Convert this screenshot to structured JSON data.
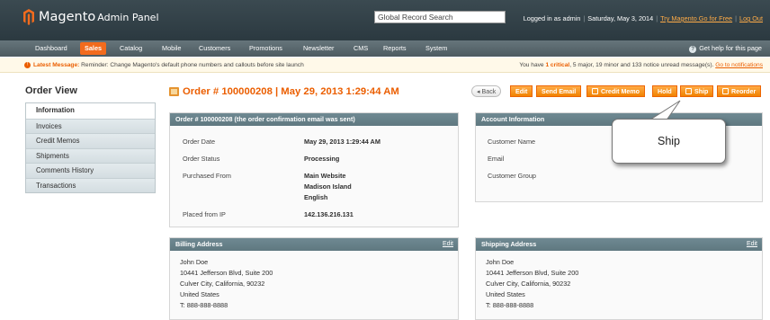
{
  "header": {
    "logo_brand": "Magento",
    "logo_sub": "Admin Panel",
    "global_search": "Global Record Search",
    "logged_in": "Logged in as admin",
    "date": "Saturday, May 3, 2014",
    "try_link": "Try Magento Go for Free",
    "logout": "Log Out"
  },
  "nav": {
    "items": [
      "Dashboard",
      "Sales",
      "Catalog",
      "Mobile",
      "Customers",
      "Promotions",
      "Newsletter",
      "CMS",
      "Reports",
      "System"
    ],
    "active": "Sales",
    "help": "Get help for this page"
  },
  "message": {
    "label": "Latest Message:",
    "text": "Reminder: Change Magento's default phone numbers and callouts before site launch",
    "right_pre": "You have",
    "critical": "1 critical",
    "right_post": ", 5 major, 19 minor and 133 notice unread message(s).",
    "link": "Go to notifications"
  },
  "sidebar": {
    "title": "Order View",
    "tabs": [
      "Information",
      "Invoices",
      "Credit Memos",
      "Shipments",
      "Comments History",
      "Transactions"
    ]
  },
  "page": {
    "title": "Order # 100000208 | May 29, 2013 1:29:44 AM"
  },
  "buttons": {
    "back": "Back",
    "edit": "Edit",
    "send_email": "Send Email",
    "credit_memo": "Credit Memo",
    "hold": "Hold",
    "ship": "Ship",
    "reorder": "Reorder"
  },
  "order_box": {
    "header": "Order # 100000208 (the order confirmation email was sent)",
    "labels": [
      "Order Date",
      "Order Status",
      "Purchased From",
      "Placed from IP"
    ],
    "order_date": "May 29, 2013 1:29:44 AM",
    "status": "Processing",
    "purchased_from": [
      "Main Website",
      "Madison Island",
      "English"
    ],
    "ip": "142.136.216.131"
  },
  "account_box": {
    "header": "Account Information",
    "labels": [
      "Customer Name",
      "Email",
      "Customer Group"
    ]
  },
  "billing": {
    "header": "Billing Address",
    "edit": "Edit",
    "lines": [
      "John Doe",
      "10441 Jefferson Blvd, Suite 200",
      "Culver City, California, 90232",
      "United States",
      "T: 888-888-8888"
    ]
  },
  "shipping": {
    "header": "Shipping Address",
    "edit": "Edit",
    "lines": [
      "John Doe",
      "10441 Jefferson Blvd, Suite 200",
      "Culver City, California, 90232",
      "United States",
      "T: 888-888-8888"
    ]
  },
  "callout": {
    "text": "Ship"
  },
  "colors": {
    "accent": "#eb5e00",
    "header_bg": "#2b3940",
    "box_head": "#6f8992"
  }
}
